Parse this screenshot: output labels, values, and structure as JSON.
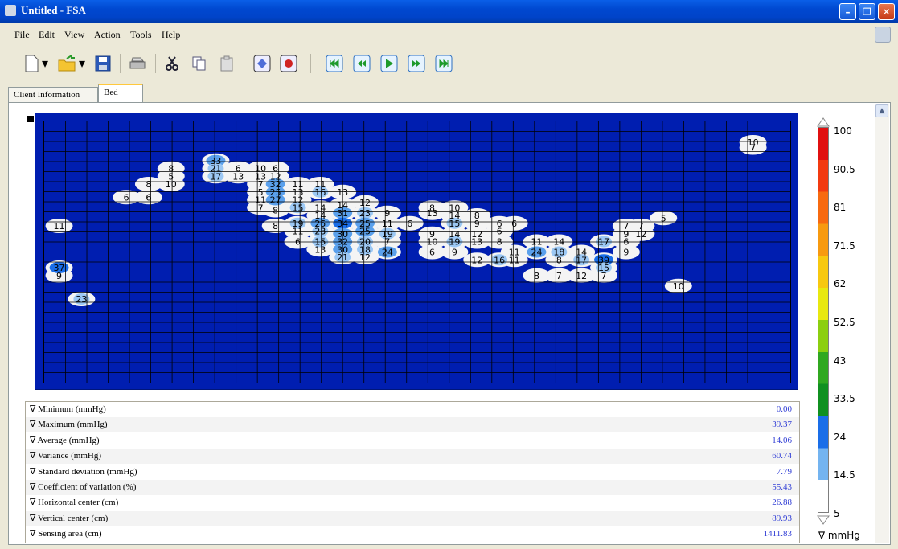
{
  "window": {
    "title": "Untitled - FSA"
  },
  "menu": [
    "File",
    "Edit",
    "View",
    "Action",
    "Tools",
    "Help"
  ],
  "toolbar_icons": [
    "new-file-icon",
    "open-folder-icon",
    "save-icon",
    "print-icon",
    "cut-icon",
    "copy-icon",
    "paste-icon",
    "diamond-icon",
    "record-icon",
    "skip-first-icon",
    "rewind-icon",
    "play-icon",
    "fast-forward-icon",
    "skip-last-icon"
  ],
  "tabs": [
    {
      "label": "Client Information"
    },
    {
      "label": "Bed",
      "active": true
    }
  ],
  "heatmap": {
    "labels": [
      {
        "t": "10",
        "c": 0.95,
        "r": 0.08
      },
      {
        "t": "7",
        "c": 0.95,
        "r": 0.1
      },
      {
        "t": "33",
        "c": 0.23,
        "r": 0.15
      },
      {
        "t": "21",
        "c": 0.23,
        "r": 0.18
      },
      {
        "t": "17",
        "c": 0.23,
        "r": 0.21
      },
      {
        "t": "6",
        "c": 0.26,
        "r": 0.18
      },
      {
        "t": "13",
        "c": 0.26,
        "r": 0.21
      },
      {
        "t": "10",
        "c": 0.29,
        "r": 0.18
      },
      {
        "t": "13",
        "c": 0.29,
        "r": 0.21
      },
      {
        "t": "6",
        "c": 0.31,
        "r": 0.18
      },
      {
        "t": "12",
        "c": 0.31,
        "r": 0.21
      },
      {
        "t": "8",
        "c": 0.17,
        "r": 0.18
      },
      {
        "t": "5",
        "c": 0.17,
        "r": 0.21
      },
      {
        "t": "8",
        "c": 0.14,
        "r": 0.24
      },
      {
        "t": "10",
        "c": 0.17,
        "r": 0.24
      },
      {
        "t": "6",
        "c": 0.11,
        "r": 0.29
      },
      {
        "t": "6",
        "c": 0.14,
        "r": 0.29
      },
      {
        "t": "11",
        "c": 0.02,
        "r": 0.4
      },
      {
        "t": "37",
        "c": 0.02,
        "r": 0.56
      },
      {
        "t": "9",
        "c": 0.02,
        "r": 0.59
      },
      {
        "t": "23",
        "c": 0.05,
        "r": 0.68
      },
      {
        "t": "7",
        "c": 0.29,
        "r": 0.24
      },
      {
        "t": "5",
        "c": 0.29,
        "r": 0.27
      },
      {
        "t": "11",
        "c": 0.29,
        "r": 0.3
      },
      {
        "t": "7",
        "c": 0.29,
        "r": 0.33
      },
      {
        "t": "32",
        "c": 0.31,
        "r": 0.24
      },
      {
        "t": "25",
        "c": 0.31,
        "r": 0.27
      },
      {
        "t": "27",
        "c": 0.31,
        "r": 0.3
      },
      {
        "t": "8",
        "c": 0.31,
        "r": 0.34
      },
      {
        "t": "8",
        "c": 0.31,
        "r": 0.4
      },
      {
        "t": "11",
        "c": 0.34,
        "r": 0.24
      },
      {
        "t": "13",
        "c": 0.34,
        "r": 0.27
      },
      {
        "t": "12",
        "c": 0.34,
        "r": 0.3
      },
      {
        "t": "15",
        "c": 0.34,
        "r": 0.33
      },
      {
        "t": "19",
        "c": 0.34,
        "r": 0.39
      },
      {
        "t": "11",
        "c": 0.34,
        "r": 0.42
      },
      {
        "t": "6",
        "c": 0.34,
        "r": 0.46
      },
      {
        "t": "11",
        "c": 0.37,
        "r": 0.24
      },
      {
        "t": "16",
        "c": 0.37,
        "r": 0.27
      },
      {
        "t": "14",
        "c": 0.37,
        "r": 0.33
      },
      {
        "t": "14",
        "c": 0.37,
        "r": 0.36
      },
      {
        "t": "25",
        "c": 0.37,
        "r": 0.39
      },
      {
        "t": "23",
        "c": 0.37,
        "r": 0.42
      },
      {
        "t": "15",
        "c": 0.37,
        "r": 0.46
      },
      {
        "t": "13",
        "c": 0.37,
        "r": 0.49
      },
      {
        "t": "13",
        "c": 0.4,
        "r": 0.27
      },
      {
        "t": "14",
        "c": 0.4,
        "r": 0.32
      },
      {
        "t": "31",
        "c": 0.4,
        "r": 0.35
      },
      {
        "t": "34",
        "c": 0.4,
        "r": 0.39
      },
      {
        "t": "30",
        "c": 0.4,
        "r": 0.43
      },
      {
        "t": "32",
        "c": 0.4,
        "r": 0.46
      },
      {
        "t": "30",
        "c": 0.4,
        "r": 0.49
      },
      {
        "t": "21",
        "c": 0.4,
        "r": 0.52
      },
      {
        "t": "12",
        "c": 0.43,
        "r": 0.31
      },
      {
        "t": "23",
        "c": 0.43,
        "r": 0.35
      },
      {
        "t": "25",
        "c": 0.43,
        "r": 0.39
      },
      {
        "t": "25",
        "c": 0.43,
        "r": 0.42
      },
      {
        "t": "20",
        "c": 0.43,
        "r": 0.46
      },
      {
        "t": "18",
        "c": 0.43,
        "r": 0.49
      },
      {
        "t": "12",
        "c": 0.43,
        "r": 0.52
      },
      {
        "t": "9",
        "c": 0.46,
        "r": 0.35
      },
      {
        "t": "11",
        "c": 0.46,
        "r": 0.39
      },
      {
        "t": "19",
        "c": 0.46,
        "r": 0.43
      },
      {
        "t": "7",
        "c": 0.46,
        "r": 0.46
      },
      {
        "t": "24",
        "c": 0.46,
        "r": 0.5
      },
      {
        "t": "6",
        "c": 0.49,
        "r": 0.39
      },
      {
        "t": "8",
        "c": 0.52,
        "r": 0.33
      },
      {
        "t": "13",
        "c": 0.52,
        "r": 0.35
      },
      {
        "t": "9",
        "c": 0.52,
        "r": 0.43
      },
      {
        "t": "10",
        "c": 0.52,
        "r": 0.46
      },
      {
        "t": "6",
        "c": 0.52,
        "r": 0.5
      },
      {
        "t": "10",
        "c": 0.55,
        "r": 0.33
      },
      {
        "t": "14",
        "c": 0.55,
        "r": 0.36
      },
      {
        "t": "15",
        "c": 0.55,
        "r": 0.39
      },
      {
        "t": "14",
        "c": 0.55,
        "r": 0.43
      },
      {
        "t": "19",
        "c": 0.55,
        "r": 0.46
      },
      {
        "t": "9",
        "c": 0.55,
        "r": 0.5
      },
      {
        "t": "8",
        "c": 0.58,
        "r": 0.36
      },
      {
        "t": "9",
        "c": 0.58,
        "r": 0.39
      },
      {
        "t": "12",
        "c": 0.58,
        "r": 0.43
      },
      {
        "t": "13",
        "c": 0.58,
        "r": 0.46
      },
      {
        "t": "12",
        "c": 0.58,
        "r": 0.53
      },
      {
        "t": "6",
        "c": 0.61,
        "r": 0.39
      },
      {
        "t": "6",
        "c": 0.61,
        "r": 0.42
      },
      {
        "t": "8",
        "c": 0.61,
        "r": 0.46
      },
      {
        "t": "16",
        "c": 0.61,
        "r": 0.53
      },
      {
        "t": "6",
        "c": 0.63,
        "r": 0.39
      },
      {
        "t": "11",
        "c": 0.63,
        "r": 0.5
      },
      {
        "t": "11",
        "c": 0.63,
        "r": 0.53
      },
      {
        "t": "11",
        "c": 0.66,
        "r": 0.46
      },
      {
        "t": "24",
        "c": 0.66,
        "r": 0.5
      },
      {
        "t": "8",
        "c": 0.66,
        "r": 0.59
      },
      {
        "t": "14",
        "c": 0.69,
        "r": 0.46
      },
      {
        "t": "18",
        "c": 0.69,
        "r": 0.5
      },
      {
        "t": "8",
        "c": 0.69,
        "r": 0.53
      },
      {
        "t": "7",
        "c": 0.69,
        "r": 0.59
      },
      {
        "t": "14",
        "c": 0.72,
        "r": 0.5
      },
      {
        "t": "17",
        "c": 0.72,
        "r": 0.53
      },
      {
        "t": "12",
        "c": 0.72,
        "r": 0.59
      },
      {
        "t": "17",
        "c": 0.75,
        "r": 0.46
      },
      {
        "t": "39",
        "c": 0.75,
        "r": 0.53
      },
      {
        "t": "15",
        "c": 0.75,
        "r": 0.56
      },
      {
        "t": "7",
        "c": 0.75,
        "r": 0.59
      },
      {
        "t": "7",
        "c": 0.78,
        "r": 0.4
      },
      {
        "t": "9",
        "c": 0.78,
        "r": 0.43
      },
      {
        "t": "6",
        "c": 0.78,
        "r": 0.46
      },
      {
        "t": "9",
        "c": 0.78,
        "r": 0.5
      },
      {
        "t": "7",
        "c": 0.8,
        "r": 0.4
      },
      {
        "t": "12",
        "c": 0.8,
        "r": 0.43
      },
      {
        "t": "5",
        "c": 0.83,
        "r": 0.37
      },
      {
        "t": "10",
        "c": 0.85,
        "r": 0.63
      }
    ]
  },
  "stats": [
    {
      "label": "Minimum (mmHg)",
      "value": "0.00"
    },
    {
      "label": "Maximum (mmHg)",
      "value": "39.37"
    },
    {
      "label": "Average (mmHg)",
      "value": "14.06"
    },
    {
      "label": "Variance (mmHg)",
      "value": "60.74"
    },
    {
      "label": "Standard deviation (mmHg)",
      "value": "7.79"
    },
    {
      "label": "Coefficient of variation (%)",
      "value": "55.43"
    },
    {
      "label": "Horizontal center (cm)",
      "value": "26.88"
    },
    {
      "label": "Vertical center (cm)",
      "value": "89.93"
    },
    {
      "label": "Sensing area (cm)",
      "value": "1411.83"
    }
  ],
  "stat_marker": "∇",
  "legend": {
    "ticks": [
      "100",
      "90.5",
      "81",
      "71.5",
      "62",
      "52.5",
      "43",
      "33.5",
      "24",
      "14.5",
      "5"
    ],
    "unit": "∇ mmHg",
    "colors": [
      "#e01010",
      "#f23a10",
      "#f76a10",
      "#f79a10",
      "#f7c810",
      "#e8e810",
      "#8ccf10",
      "#30a820",
      "#109020",
      "#1a6ee8",
      "#74b4f0",
      "#ffffff"
    ]
  }
}
